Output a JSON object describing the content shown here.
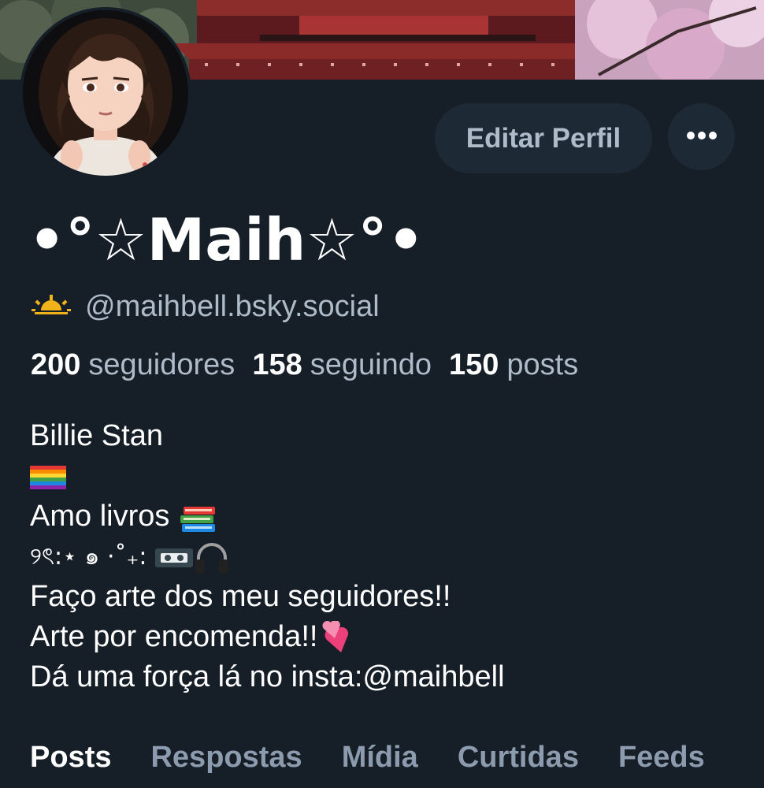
{
  "profile": {
    "display_name": "•°☆Maih☆°•",
    "handle": "@maihbell.bsky.social",
    "handle_icon": "sunrise-icon"
  },
  "actions": {
    "edit_label": "Editar Perfil",
    "more_icon": "more-horizontal-icon"
  },
  "stats": {
    "followers_count": "200",
    "followers_label": "seguidores",
    "following_count": "158",
    "following_label": "seguindo",
    "posts_count": "150",
    "posts_label": "posts"
  },
  "bio": {
    "line1": "Billie Stan",
    "line2_icon": "rainbow-flag-icon",
    "line3": "Amo livros",
    "line3_icon": "books-icon",
    "line4": "୨ৎ:⋆ ๑ ·˚₊:",
    "line4_icons": [
      "vhs-tape-icon",
      "headphones-icon"
    ],
    "line5": "Faço arte dos meu seguidores!!",
    "line6": "Arte por encomenda!!",
    "line6_icon": "two-hearts-icon",
    "line7": "Dá uma força lá no insta:@maihbell"
  },
  "tabs": [
    {
      "label": "Posts",
      "active": true
    },
    {
      "label": "Respostas",
      "active": false
    },
    {
      "label": "Mídia",
      "active": false
    },
    {
      "label": "Curtidas",
      "active": false
    },
    {
      "label": "Feeds",
      "active": false
    }
  ],
  "colors": {
    "background": "#161e27",
    "button_bg": "#1e2936",
    "muted_text": "#aebbc9",
    "inactive_tab": "#8c9bad"
  }
}
